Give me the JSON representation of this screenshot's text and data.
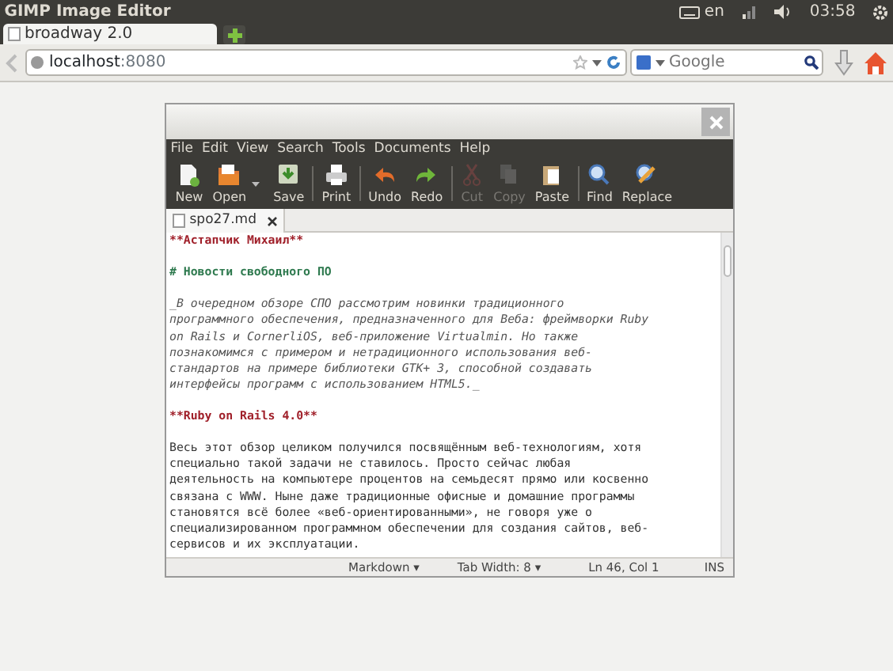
{
  "panel": {
    "title": "GIMP Image Editor",
    "language": "en",
    "clock": "03:58"
  },
  "browser": {
    "tabs": [
      {
        "label": "broadway 2.0",
        "selected": true
      }
    ],
    "url_host": "localhost",
    "url_port": ":8080",
    "search": {
      "placeholder": "Google"
    }
  },
  "editor": {
    "menu": [
      "File",
      "Edit",
      "View",
      "Search",
      "Tools",
      "Documents",
      "Help"
    ],
    "toolbar": [
      {
        "kind": "new",
        "label": "New",
        "disabled": false
      },
      {
        "kind": "open",
        "label": "Open",
        "disabled": false
      },
      {
        "kind": "save",
        "label": "Save",
        "disabled": false
      },
      {
        "kind": "separator"
      },
      {
        "kind": "print",
        "label": "Print",
        "disabled": false
      },
      {
        "kind": "separator"
      },
      {
        "kind": "undo",
        "label": "Undo",
        "disabled": false
      },
      {
        "kind": "redo",
        "label": "Redo",
        "disabled": false
      },
      {
        "kind": "separator"
      },
      {
        "kind": "cut",
        "label": "Cut",
        "disabled": true
      },
      {
        "kind": "copy",
        "label": "Copy",
        "disabled": true
      },
      {
        "kind": "paste",
        "label": "Paste",
        "disabled": false
      },
      {
        "kind": "separator"
      },
      {
        "kind": "find",
        "label": "Find",
        "disabled": false
      },
      {
        "kind": "replace",
        "label": "Replace",
        "disabled": false
      }
    ],
    "doc_tabs": [
      {
        "label": "spo27.md",
        "selected": true
      }
    ],
    "lines": [
      {
        "kind": "bold",
        "text": "**Астапчик Михаил**"
      },
      {
        "kind": "blank"
      },
      {
        "kind": "heading",
        "text": "# Новости свободного ПО"
      },
      {
        "kind": "blank"
      },
      {
        "kind": "italic",
        "text": "_В очередном обзоре СПО рассмотрим новинки традиционного"
      },
      {
        "kind": "italic",
        "text": "программного обеспечения, предназначенного для Веба: фреймворки Ruby"
      },
      {
        "kind": "italic",
        "text": "on Rails и CornerliOS, веб-приложение Virtualmin. Но также"
      },
      {
        "kind": "italic",
        "text": "познакомимся с примером и нетрадиционного использования веб-"
      },
      {
        "kind": "italic",
        "text": "стандартов на примере библиотеки GTK+ 3, способной создавать"
      },
      {
        "kind": "italic",
        "text": "интерфейсы программ с использованием HTML5._"
      },
      {
        "kind": "blank"
      },
      {
        "kind": "bold",
        "text": "**Ruby on Rails 4.0**"
      },
      {
        "kind": "blank"
      },
      {
        "kind": "plain",
        "text": "Весь этот обзор целиком получился посвящённым веб-технологиям, хотя"
      },
      {
        "kind": "plain",
        "text": "специально такой задачи не ставилось. Просто сейчас любая"
      },
      {
        "kind": "plain",
        "text": "деятельность на компьютере процентов на семьдесят прямо или косвенно"
      },
      {
        "kind": "plain",
        "text": "связана с WWW. Ныне даже традиционные офисные и домашние программы"
      },
      {
        "kind": "plain",
        "text": "становятся всё более «веб-ориентированными», не говоря уже о"
      },
      {
        "kind": "plain",
        "text": "специализированном программном обеспечении для создания сайтов, веб-"
      },
      {
        "kind": "plain",
        "text": "сервисов и их эксплуатации."
      }
    ],
    "status": {
      "language": "Markdown ▾",
      "tab_width": "Tab Width: 8 ▾",
      "position": "Ln 46, Col 1",
      "mode": "INS"
    }
  }
}
